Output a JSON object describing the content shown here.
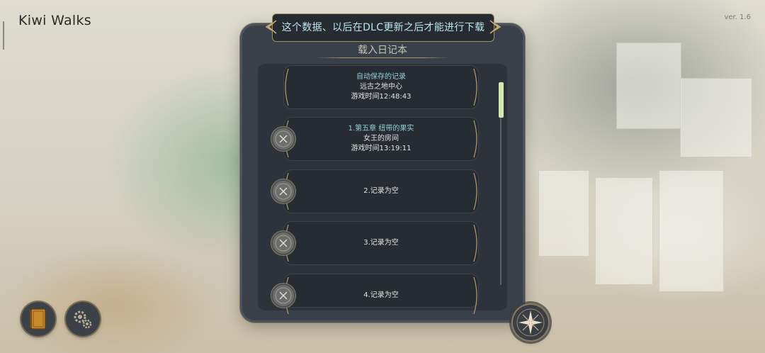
{
  "app": {
    "title": "Kiwi Walks",
    "version": "ver. 1.6"
  },
  "notice": {
    "text": "这个数据、以后在DLC更新之后才能进行下载"
  },
  "dialog": {
    "heading": "载入日记本",
    "slots": [
      {
        "line1": "自动保存的记录",
        "line2": "远古之地中心",
        "line3": "游戏时间12:48:43",
        "deletable": false
      },
      {
        "line1": "1.第五章 纽带的果实",
        "line2": "女王的房间",
        "line3": "游戏时间13:19:11",
        "deletable": true
      },
      {
        "label": "2.记录为空",
        "deletable": true
      },
      {
        "label": "3.记录为空",
        "deletable": true
      },
      {
        "label": "4.记录为空",
        "deletable": true
      }
    ],
    "scroll_position": 0
  },
  "icons": {
    "delete": "close-x-icon",
    "journal": "book-icon",
    "settings": "gears-icon",
    "compass": "compass-star-icon"
  },
  "colors": {
    "panel": "#3a4049",
    "accent_text": "#8fd2d6",
    "notice_text": "#bfe6ee",
    "scroll_thumb": "#d4e9b0",
    "trim": "#a58f62"
  }
}
